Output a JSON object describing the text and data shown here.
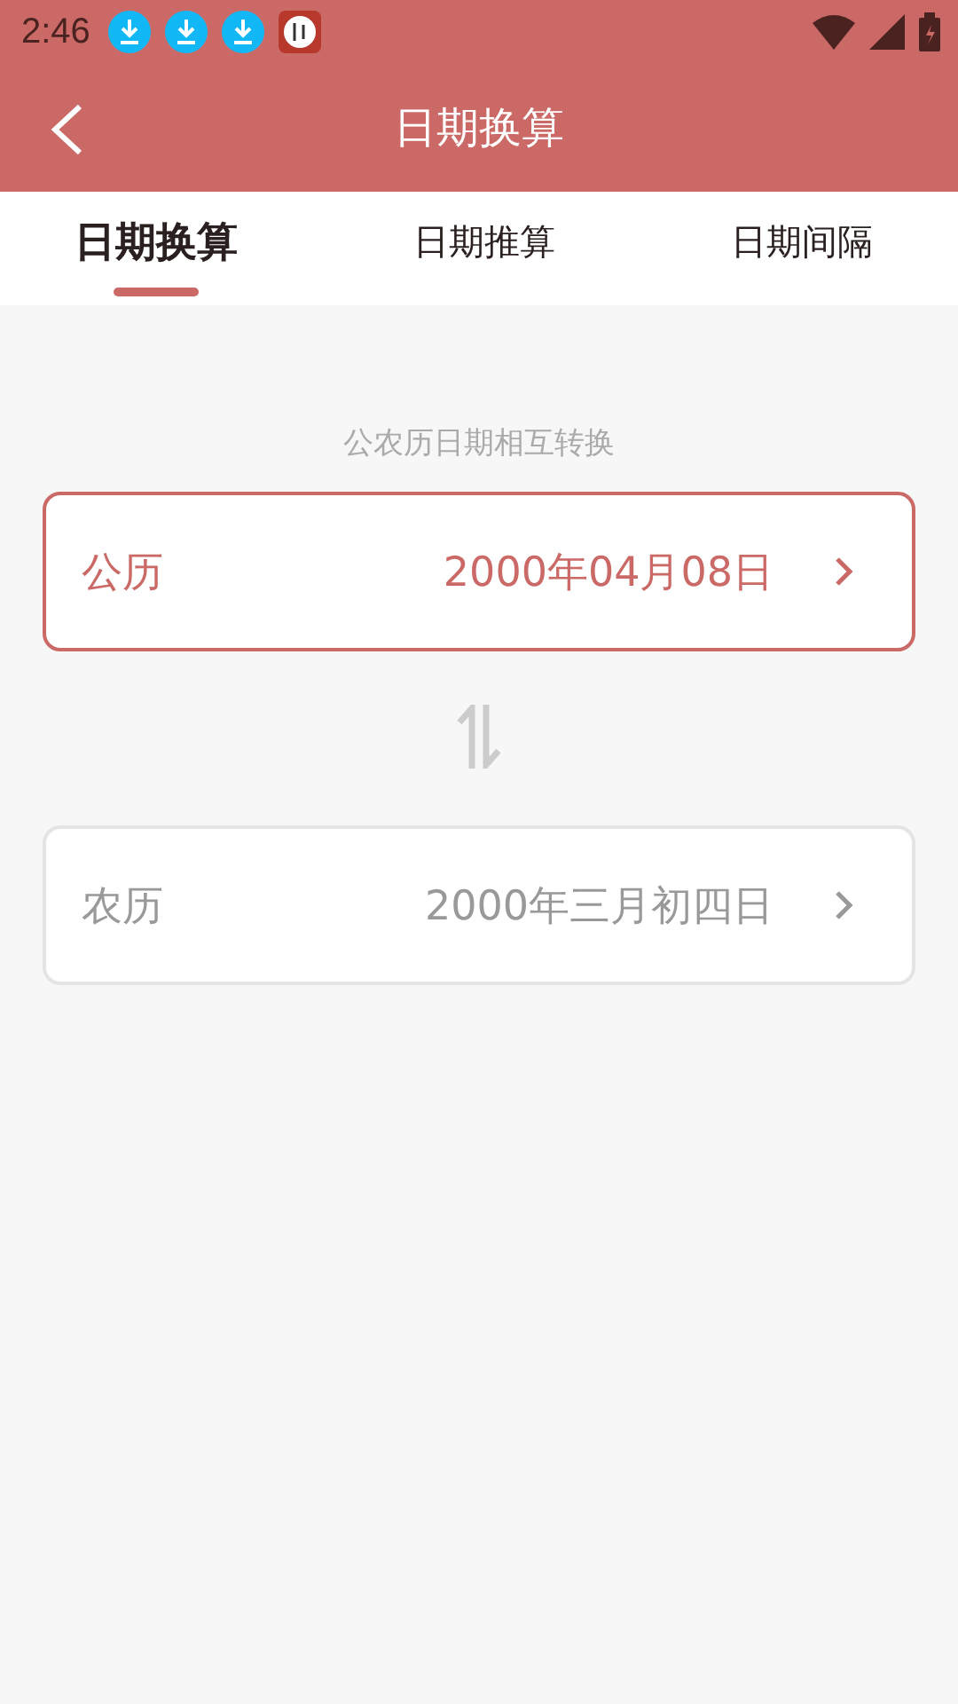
{
  "status_bar": {
    "time": "2:46",
    "notifications": [
      {
        "kind": "download"
      },
      {
        "kind": "download"
      },
      {
        "kind": "download"
      },
      {
        "kind": "app"
      }
    ]
  },
  "header": {
    "title": "日期换算"
  },
  "tabs": [
    {
      "label": "日期换算",
      "selected": true
    },
    {
      "label": "日期推算",
      "selected": false
    },
    {
      "label": "日期间隔",
      "selected": false
    }
  ],
  "subtitle": "公农历日期相互转换",
  "cards": [
    {
      "label": "公历",
      "value": "2000年04月08日",
      "selected": true
    },
    {
      "label": "农历",
      "value": "2000年三月初四日",
      "selected": false
    }
  ]
}
